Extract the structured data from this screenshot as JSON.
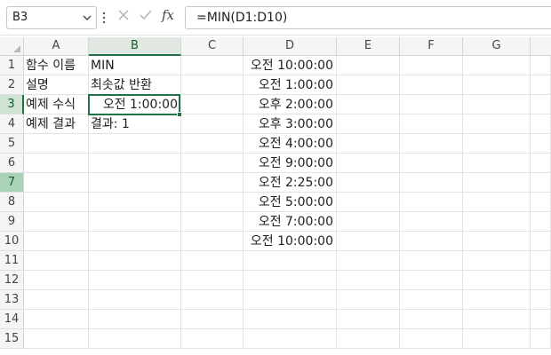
{
  "formula_bar": {
    "name_box": "B3",
    "fx_label": "fx",
    "formula": "=MIN(D1:D10)"
  },
  "columns": [
    "A",
    "B",
    "C",
    "D",
    "E",
    "F",
    "G"
  ],
  "selected_column": "B",
  "rows": [
    "1",
    "2",
    "3",
    "4",
    "5",
    "6",
    "7",
    "8",
    "9",
    "10",
    "11",
    "12",
    "13",
    "14",
    "15"
  ],
  "selected_row": "3",
  "highlighted_row": "7",
  "cells": {
    "A1": "함수 이름",
    "B1": "MIN",
    "A2": "설명",
    "B2": "최솟값 반환",
    "A3": "예제 수식",
    "B3": "오전 1:00:00",
    "A4": "예제 결과",
    "B4": "결과: 1",
    "D1": "오전 10:00:00",
    "D2": "오전 1:00:00",
    "D3": "오후 2:00:00",
    "D4": "오후 3:00:00",
    "D5": "오전 4:00:00",
    "D6": "오전 9:00:00",
    "D7": "오전 2:25:00",
    "D8": "오전 5:00:00",
    "D9": "오전 7:00:00",
    "D10": "오전 10:00:00"
  },
  "colors": {
    "accent": "#217346"
  }
}
